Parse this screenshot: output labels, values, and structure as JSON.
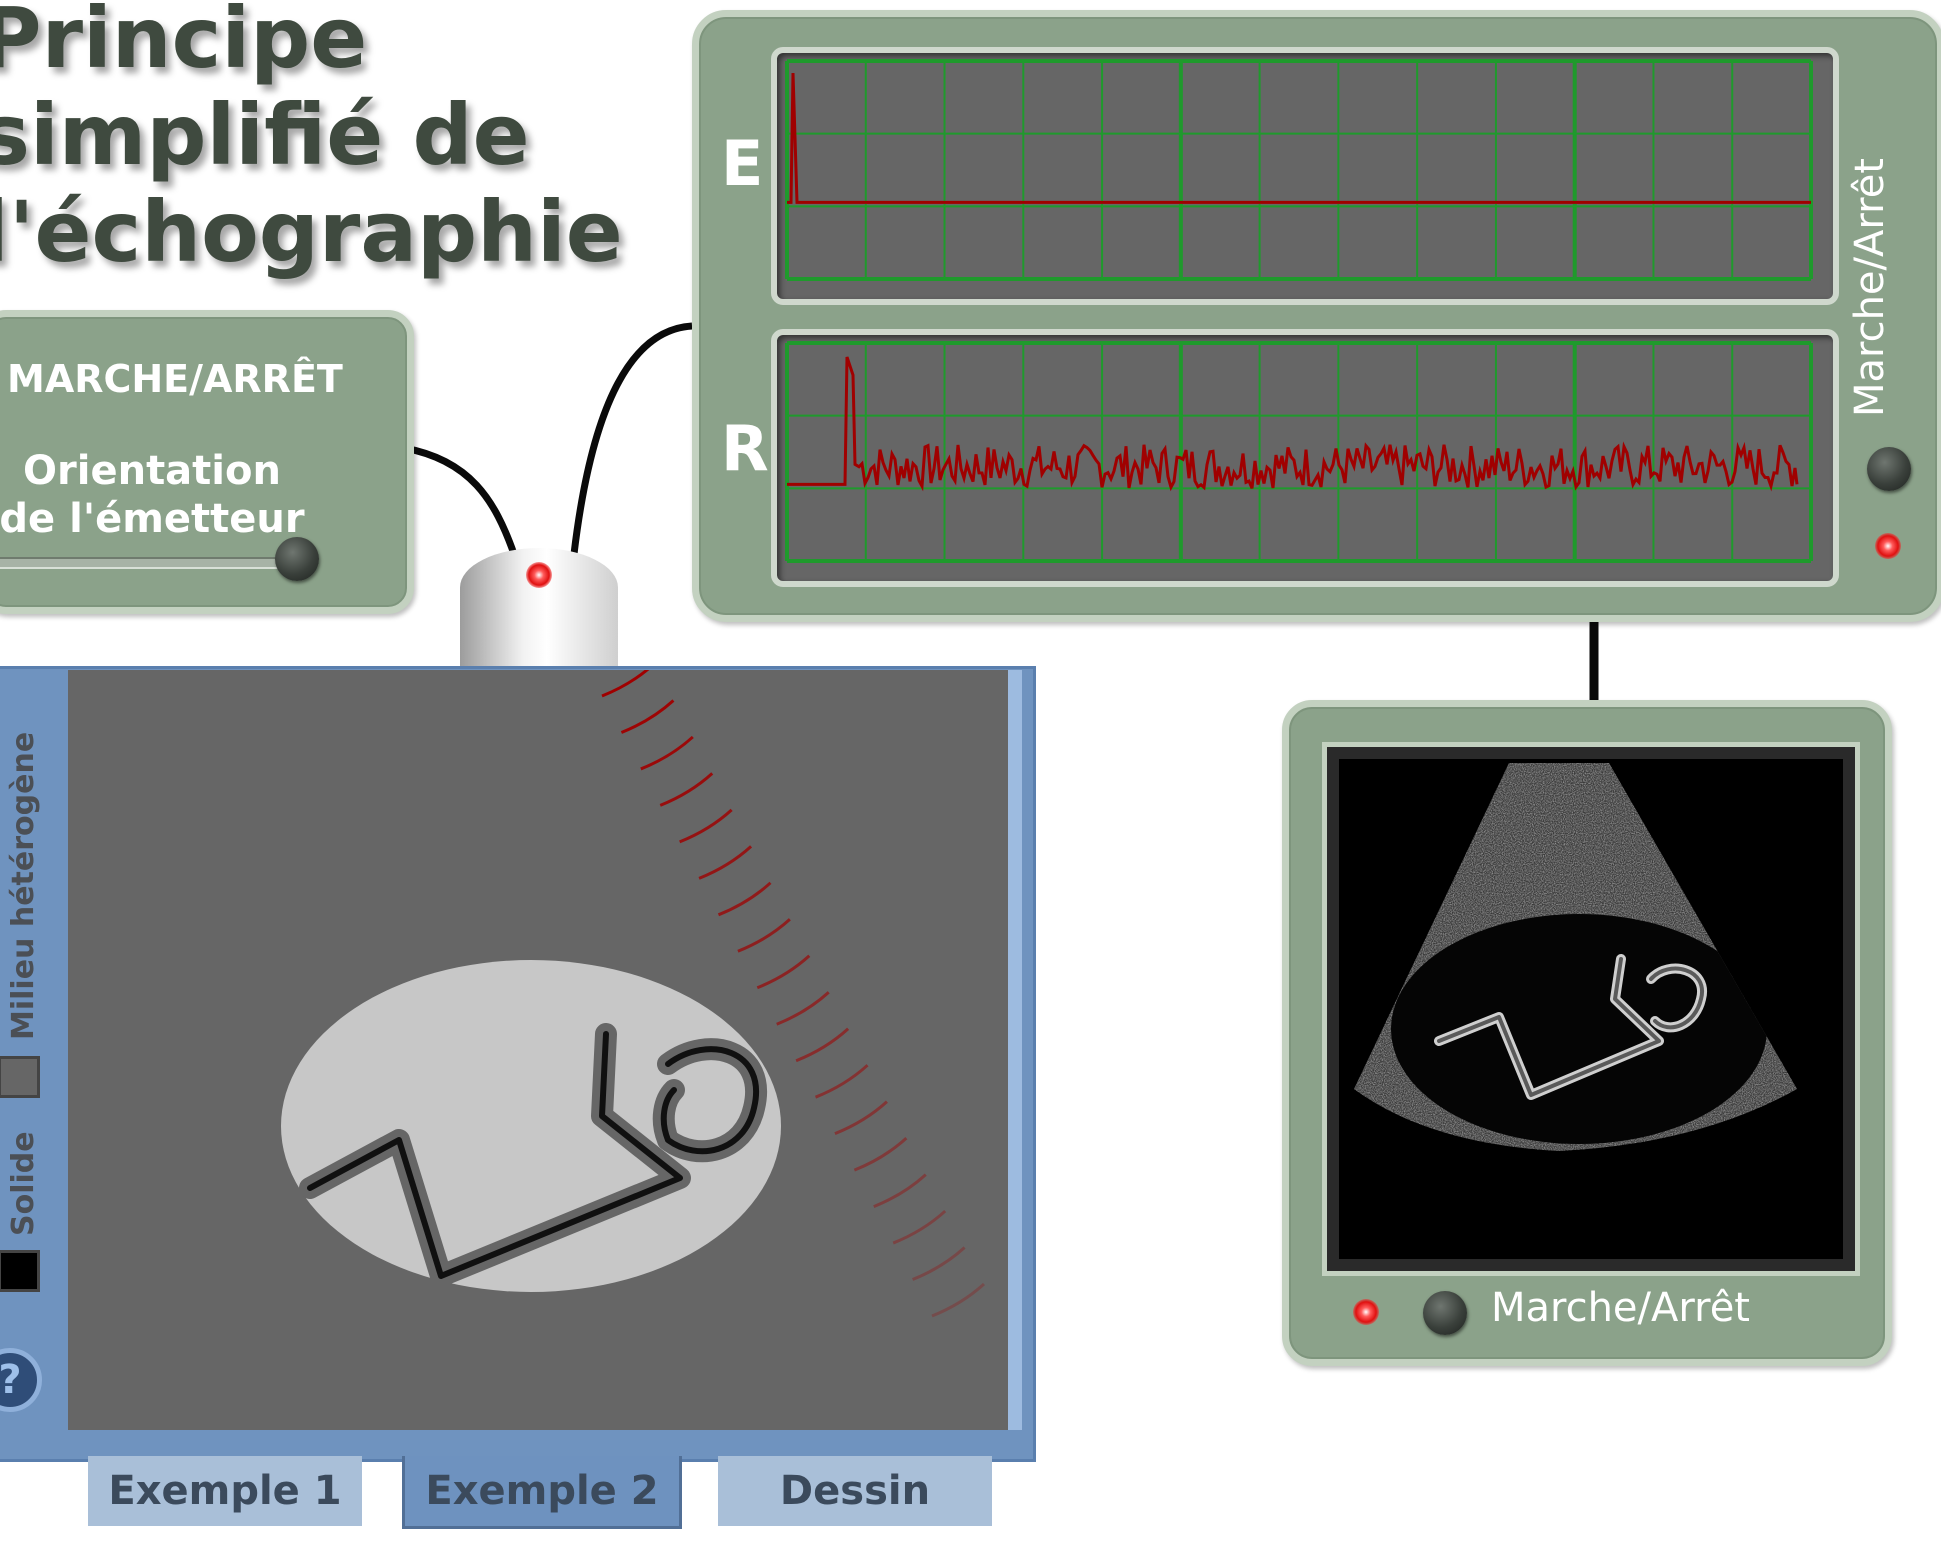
{
  "title": {
    "line1": "Principe",
    "line2": "simplifié de",
    "line3": "l'échographie"
  },
  "control_panel": {
    "power_label": "MARCHE/ARRÊT",
    "orientation_label_line1": "Orientation",
    "orientation_label_line2": "de l'émetteur"
  },
  "oscilloscope": {
    "channel_e": "E",
    "channel_r": "R",
    "power_label": "Marche/Arrêt"
  },
  "monitor": {
    "power_label": "Marche/Arrêt"
  },
  "medium": {
    "heterogeneous_label": "Milieu hétérogène",
    "solid_label": "Solide",
    "help_symbol": "?"
  },
  "tabs": [
    {
      "label": "Exemple 1"
    },
    {
      "label": "Exemple 2"
    },
    {
      "label": "Dessin"
    }
  ],
  "colors": {
    "panel": "#8ba28a",
    "panel_border": "#c3d1c0",
    "grid": "#1f9a2c",
    "signal": "#a00000",
    "led": "#ff2020",
    "sim_frame": "#6f93bf"
  }
}
